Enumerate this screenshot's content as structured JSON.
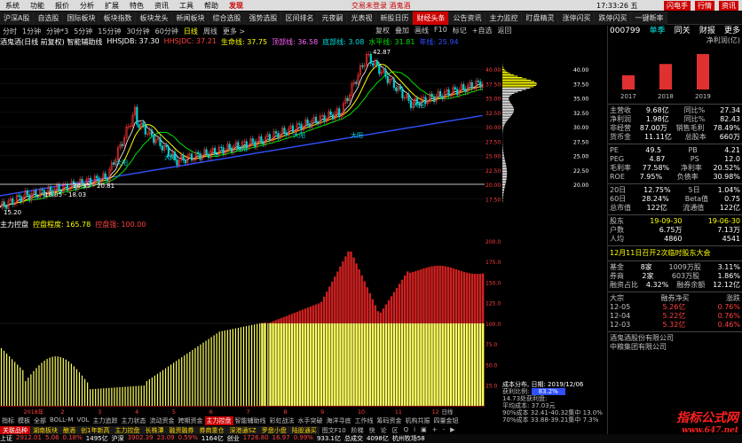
{
  "menubar": {
    "items": [
      "系统",
      "功能",
      "报价",
      "分析",
      "扩展",
      "特色",
      "资讯",
      "工具",
      "帮助"
    ],
    "hot_item": "发现",
    "login": "交易未登录",
    "stock_tab": "酒鬼酒",
    "time": "17:33:26 五",
    "right": [
      "闪电手",
      "行情",
      "资讯"
    ]
  },
  "tabs": [
    "沪深A股",
    "自选股",
    "国际板块",
    "板块指数",
    "板块龙头",
    "新闻板块",
    "综合选股",
    "强势选股",
    "区间排名",
    "元夜嗣",
    "光表视",
    "新股日历",
    "财经头条",
    "公告资讯",
    "主力监控",
    "盯盘精灵",
    "涨停闪买",
    "跌停闪买",
    "一键断率"
  ],
  "active_tab": "财经头条",
  "toolbar": {
    "periods": [
      "分时",
      "1分钟",
      "分钟*3",
      "5分钟",
      "15分钟",
      "30分钟",
      "60分钟",
      "日线",
      "周线",
      "更多 >"
    ],
    "active": "日线",
    "right": [
      "复权",
      "叠加",
      "画线",
      "F10",
      "标记",
      "+自选",
      "返回"
    ]
  },
  "chart_legend": {
    "name": "酒鬼酒(日线 前复权) 智能辅助线",
    "items": [
      {
        "label": "HHSJDB: 37.30",
        "color": "#ffffff"
      },
      {
        "label": "HHSJDC: 37.21",
        "color": "#ff4040"
      },
      {
        "label": "生命线: 37.75",
        "color": "#ffff00"
      },
      {
        "label": "顶部线: 36.58",
        "color": "#ff66ff"
      },
      {
        "label": "底部线: 3.08",
        "color": "#00e0e0"
      },
      {
        "label": "水平线: 31.81",
        "color": "#00e000"
      },
      {
        "label": "年线: 25.94",
        "color": "#3050ff"
      }
    ]
  },
  "price_axis": [
    "40.00",
    "37.50",
    "35.00",
    "32.50",
    "30.00",
    "27.50",
    "25.00",
    "22.50",
    "20.00",
    "17.50"
  ],
  "price_labels": {
    "high": "42.87",
    "low": "15.20",
    "range1": "20.35 - 20.81",
    "range2": "18.05 - 18.03"
  },
  "chart_tags": [
    "大阳",
    "大阳",
    "大阳",
    "大阳",
    "大阳",
    "大阳"
  ],
  "indicator_legend": {
    "name": "主力控盘",
    "items": [
      {
        "label": "控盘程度: 165.78",
        "color": "#ffff00"
      },
      {
        "label": "控盘强: 100.00",
        "color": "#ff4040"
      }
    ]
  },
  "ind_axis": [
    "200.0",
    "175.0",
    "150.0",
    "125.0",
    "100.0",
    "75.0",
    "50.0",
    "25.0"
  ],
  "xaxis": [
    "2018年",
    "2",
    "3",
    "4",
    "5",
    "6",
    "7",
    "8",
    "9",
    "10",
    "11",
    "12"
  ],
  "xaxis_right": "日线",
  "bottom_tabs": [
    "指标",
    "模板",
    "全部",
    "BOLL-M",
    "VOL",
    "主力追踪",
    "主力状态",
    "流动资金",
    "跨期资金",
    "主力控盘",
    "智能辅助线",
    "彩虹战法",
    "水手突破",
    "海洋寻底",
    "工作线",
    "筹码资金",
    "机构共振",
    "四量金钮"
  ],
  "active_bottom_tab": "主力控盘",
  "hot_tabs": [
    "关联品种",
    "湖南板块",
    "酿酒",
    "创1年新高",
    "主力控盘",
    "长株潭",
    "融资融券",
    "券商重仓",
    "深港通SZ",
    "罗盘小盘",
    "陆股通买"
  ],
  "bottom_row2": [
    "开/弹署",
    "扩展",
    "关联标的",
    "资金规划",
    "个股日历",
    "公司公告",
    "财经精选",
    "综合资讯",
    "行业资讯"
  ],
  "bottom_row2_right": [
    "图文F10",
    "阶梯",
    "快",
    "论",
    "区",
    "Q",
    "i",
    "▣",
    "+",
    "-",
    "▶"
  ],
  "chips": {
    "header": "成本分布, 日期: 2019/12/06",
    "profit_label": "获利比例:",
    "profit_value": "83.2%",
    "lines": [
      "14.73处获利盘:",
      "平均成本: 37.03元",
      "90%成本 32.41-40.32集中 13.0%",
      "70%成本 33.88-39.21集中 7.3%"
    ]
  },
  "chips_axis": [
    "40.00",
    "37.50",
    "35.00",
    "32.50",
    "30.00",
    "27.50",
    "25.00",
    "22.50",
    "20.00"
  ],
  "quote": {
    "code": "000799",
    "tabs": [
      "单季",
      "同关",
      "财报",
      "更多"
    ],
    "chart_title": "净利润(亿)",
    "years": [
      "2017",
      "2018",
      "2019"
    ],
    "bars": [
      {
        "year": "2017",
        "value": 1.0
      },
      {
        "year": "2018",
        "value": 1.8
      },
      {
        "year": "2019",
        "value": 2.5
      }
    ],
    "fundamentals": [
      {
        "k": "主营收",
        "v": "9.68亿",
        "k2": "同比%",
        "v2": "27.34"
      },
      {
        "k": "净利润",
        "v": "1.98亿",
        "k2": "同比%",
        "v2": "82.43"
      },
      {
        "k": "非经营",
        "v": "87.00万",
        "k2": "销售毛利",
        "v2": "78.49%"
      },
      {
        "k": "货币金",
        "v": "11.11亿",
        "k2": "总股本",
        "v2": "660万"
      }
    ],
    "valuation": [
      {
        "k": "PE",
        "v": "49.5",
        "k2": "PB",
        "v2": "4.21"
      },
      {
        "k": "PEG",
        "v": "4.87",
        "k2": "PS",
        "v2": "12.0"
      },
      {
        "k": "毛利率",
        "v": "77.58%",
        "k2": "净利率",
        "v2": "20.52%"
      },
      {
        "k": "ROE",
        "v": "7.95%",
        "k2": "负债率",
        "v2": "30.98%"
      }
    ],
    "stats": [
      {
        "k": "20日",
        "v": "12.75%",
        "k2": "5日",
        "v2": "1.04%"
      },
      {
        "k": "60日",
        "v": "28.24%",
        "k2": "Beta值",
        "v2": "0.75"
      },
      {
        "k": "总市值",
        "v": "122亿",
        "k2": "流通值",
        "v2": "122亿"
      }
    ],
    "holders_hdr": {
      "k": "股东",
      "v": "19-09-30",
      "v2": "19-06-30"
    },
    "holders": [
      {
        "k": "户数",
        "v": "6.75万",
        "v2": "7.13万"
      },
      {
        "k": "人均",
        "v": "4860",
        "v2": "4541"
      }
    ],
    "event": "12月11日召开2次临时股东大会",
    "funds": [
      {
        "k": "基金",
        "v": "8家",
        "k2": "1009万股",
        "v2": "3.11%"
      },
      {
        "k": "券商",
        "v": "2家",
        "k2": "603万股",
        "v2": "1.86%"
      }
    ],
    "margin": [
      {
        "k": "融资占比",
        "v": "4.32%",
        "k2": "融券余额",
        "v2": "12.12亿"
      }
    ],
    "flow_hdr": {
      "k": "大宗",
      "v": "融券净买",
      "v2": "涨跌"
    },
    "flow": [
      {
        "d": "12-05",
        "v": "5.26亿",
        "v2": "0.76%"
      },
      {
        "d": "12-04",
        "v": "5.22亿",
        "v2": "0.76%"
      },
      {
        "d": "12-03",
        "v": "5.32亿",
        "v2": "0.46%"
      }
    ],
    "company": "酒鬼酒股份有限公司",
    "company2": "中粮集团有限公司"
  },
  "ticker": [
    {
      "t": "1.04%",
      "c": "red"
    },
    {
      "t": "报2082.16点",
      "c": "wht"
    },
    {
      "t": "广东省政府网鹿广新控股集团、丝纺集团改革重组方案",
      "c": "wht"
    },
    {
      "t": "辽宁镇内外上市公司135家",
      "c": "wht"
    },
    {
      "t": "累计实现资本市场融资5433亿元",
      "c": "wht"
    },
    {
      "t": "投资纺丰养殖产业项目",
      "c": "wht"
    },
    {
      "t": "庄园牧场(002910)拟定增最高募资3.6亿元",
      "c": "wht"
    }
  ],
  "ticker2": [
    {
      "t": "上证",
      "c": "wht"
    },
    {
      "t": "2912.01",
      "c": "red"
    },
    {
      "t": "5.06",
      "c": "red"
    },
    {
      "t": "0.18%",
      "c": "red"
    },
    {
      "t": "1495亿",
      "c": "wht"
    },
    {
      "t": "沪深",
      "c": "wht"
    },
    {
      "t": "3902.39",
      "c": "red"
    },
    {
      "t": "23.09",
      "c": "red"
    },
    {
      "t": "0.59%",
      "c": "red"
    },
    {
      "t": "1164亿",
      "c": "wht"
    },
    {
      "t": "创业",
      "c": "wht"
    },
    {
      "t": "1726.80",
      "c": "red"
    },
    {
      "t": "16.97",
      "c": "red"
    },
    {
      "t": "0.99%",
      "c": "red"
    },
    {
      "t": "933.1亿",
      "c": "wht"
    },
    {
      "t": "总成交",
      "c": "wht"
    },
    {
      "t": "4098亿",
      "c": "wht"
    },
    {
      "t": "杭州牧场58",
      "c": "wht"
    }
  ],
  "watermark": "指标公式网",
  "watermark_url": "www.647.net",
  "colors": {
    "up": "#ff4040",
    "down": "#00e000",
    "panelbg": "#000000",
    "accent": "#cc0000",
    "yellow": "#ffff00"
  }
}
